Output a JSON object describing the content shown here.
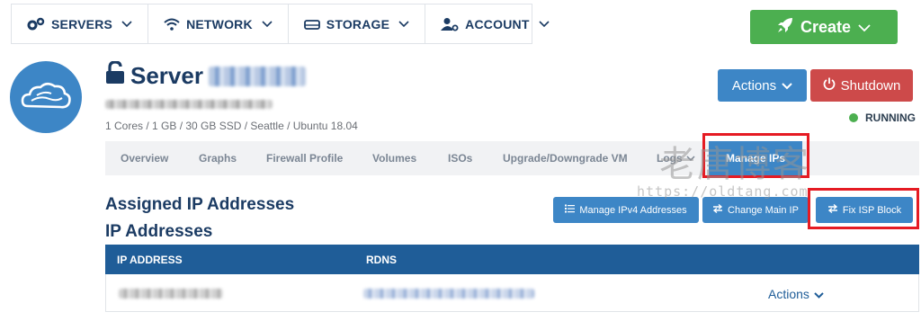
{
  "topnav": {
    "items": [
      {
        "label": "SERVERS",
        "icon": "gears-icon"
      },
      {
        "label": "NETWORK",
        "icon": "wifi-icon"
      },
      {
        "label": "STORAGE",
        "icon": "hard-drive-icon"
      },
      {
        "label": "ACCOUNT",
        "icon": "user-cog-icon"
      }
    ],
    "create_label": "Create"
  },
  "server": {
    "title_prefix": "Server",
    "specs": "1 Cores / 1 GB / 30 GB SSD / Seattle / Ubuntu 18.04",
    "status": "RUNNING",
    "status_color": "#4caf50"
  },
  "header_actions": {
    "actions_label": "Actions",
    "shutdown_label": "Shutdown"
  },
  "tabs": [
    {
      "label": "Overview"
    },
    {
      "label": "Graphs"
    },
    {
      "label": "Firewall Profile"
    },
    {
      "label": "Volumes"
    },
    {
      "label": "ISOs"
    },
    {
      "label": "Upgrade/Downgrade VM"
    },
    {
      "label": "Logs"
    },
    {
      "label": "Manage IPs",
      "active": true
    }
  ],
  "section": {
    "assigned_title": "Assigned IP Addresses",
    "ip_title": "IP Addresses",
    "buttons": {
      "manage_ipv4": "Manage IPv4 Addresses",
      "change_main_ip": "Change Main IP",
      "fix_isp_block": "Fix ISP Block"
    }
  },
  "table": {
    "columns": [
      "IP ADDRESS",
      "RDNS"
    ],
    "rows": [
      {
        "actions_label": "Actions"
      }
    ]
  },
  "watermark": {
    "chinese": "老唐博客",
    "url": "https://oldtang.com"
  },
  "colors": {
    "brand_blue": "#3d86c6",
    "navy": "#1b3b63",
    "table_header": "#1f5d98",
    "create_green": "#4caf50",
    "shutdown_red": "#cd4a4a",
    "highlight_red": "#e51b23"
  }
}
